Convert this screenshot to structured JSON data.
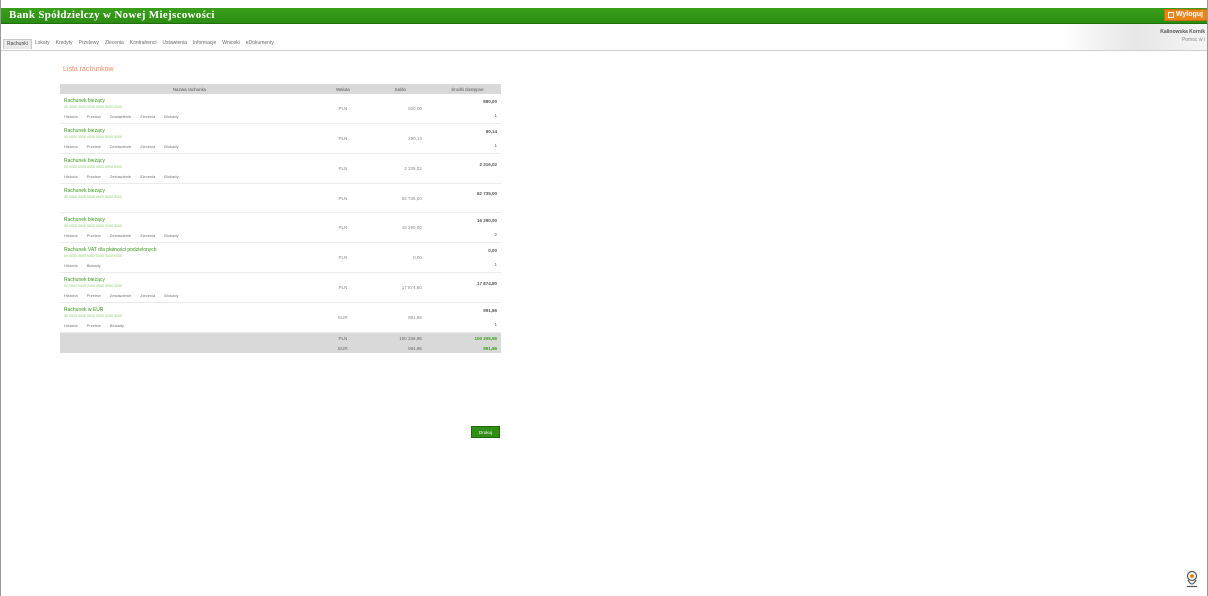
{
  "header": {
    "bank_title": "Bank Spółdzielczy w Nowej Miejscowości",
    "logout_label": "Wyloguj"
  },
  "nav": {
    "items": [
      "Rachunki",
      "Lokaty",
      "Kredyty",
      "Przelewy",
      "Zlecenia",
      "Kontrahenci",
      "Ustawienia",
      "Informacje",
      "Wnioski",
      "eDokumenty"
    ]
  },
  "user": {
    "name": "Kalinowska Kornik",
    "subtitle": "Pomoc w i"
  },
  "main": {
    "title": "Lista rachunków",
    "columns": {
      "name": "Nazwa rachunku",
      "currency": "Waluta",
      "balance": "Saldo",
      "available": "Środki dostępne"
    },
    "accounts": [
      {
        "name": "Rachunek bieżący",
        "number": "00 0000 0000 0000 0000 0000 0000",
        "currency": "PLN",
        "balance": "920,00",
        "available": "880,00",
        "count": "1",
        "links": [
          "Historia",
          "Przelew",
          "Zestawienie",
          "Zlecenia",
          "Blokady"
        ]
      },
      {
        "name": "Rachunek bieżący",
        "number": "00 0000 0000 0000 0000 0000 0000",
        "currency": "PLN",
        "balance": "290,14",
        "available": "90,14",
        "count": "1",
        "links": [
          "Historia",
          "Przelew",
          "Zestawienie",
          "Zlecenia",
          "Blokady"
        ]
      },
      {
        "name": "Rachunek bieżący",
        "number": "00 0000 0000 0000 0000 0000 0000",
        "currency": "PLN",
        "balance": "2 335,02",
        "available": "2 316,02",
        "count": "",
        "links": [
          "Historia",
          "Przelew",
          "Zestawienie",
          "Zlecenia",
          "Blokady"
        ]
      },
      {
        "name": "Rachunek bieżący",
        "number": "00 0000 0000 0000 0000 0000 0000",
        "currency": "PLN",
        "balance": "62 735,00",
        "available": "62 735,00",
        "count": "",
        "links": []
      },
      {
        "name": "Rachunek bieżący",
        "number": "00 0000 0000 0000 0000 0000 0000",
        "currency": "PLN",
        "balance": "16 290,00",
        "available": "16 290,00",
        "count": "2",
        "links": [
          "Historia",
          "Przelew",
          "Zestawienie",
          "Zlecenia",
          "Blokady"
        ]
      },
      {
        "name": "Rachunek VAT dla płatności podzielonych",
        "number": "00 0000 0000 0000 0000 0000 0000",
        "currency": "PLN",
        "balance": "0,00",
        "available": "0,00",
        "count": "1",
        "links": [
          "Historia",
          "Blokady"
        ]
      },
      {
        "name": "Rachunek bieżący",
        "number": "00 0000 0000 0000 0000 0000 0000",
        "currency": "PLN",
        "balance": "17 874,80",
        "available": "17 874,80",
        "count": "",
        "links": [
          "Historia",
          "Przelew",
          "Zestawienie",
          "Zlecenia",
          "Blokady"
        ]
      },
      {
        "name": "Rachunek w EUR",
        "number": "00 0000 0000 0000 0000 0000 0000",
        "currency": "EUR",
        "balance": "991,86",
        "available": "991,86",
        "count": "1",
        "links": [
          "Historia",
          "Przelew",
          "Blokady"
        ]
      }
    ],
    "totals": [
      {
        "currency": "PLN",
        "balance": "100 336,96",
        "available": "100 205,96"
      },
      {
        "currency": "EUR",
        "balance": "991,86",
        "available": "991,86"
      }
    ],
    "print_label": "Drukuj"
  },
  "icons": {
    "logout": "power-icon",
    "help": "help-person-icon"
  },
  "colors": {
    "banner_green": "#2b8c12",
    "account_name": "#3a9a1c",
    "title_salmon": "#f08a6a",
    "logout_orange": "#e8861a"
  }
}
